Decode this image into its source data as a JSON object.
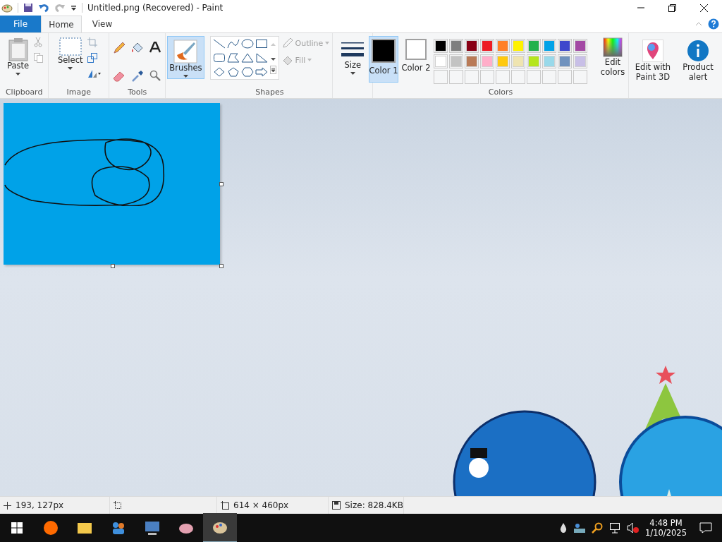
{
  "window": {
    "title": "Untitled.png (Recovered) - Paint"
  },
  "tabs": [
    {
      "label": "File",
      "kind": "file",
      "selected": false
    },
    {
      "label": "Home",
      "kind": "tab",
      "selected": true
    },
    {
      "label": "View",
      "kind": "tab",
      "selected": false
    }
  ],
  "ribbon": {
    "clipboard": {
      "label": "Clipboard",
      "paste": "Paste"
    },
    "image": {
      "label": "Image",
      "select": "Select"
    },
    "tools": {
      "label": "Tools"
    },
    "brushes": {
      "label": "Brushes",
      "selected": true
    },
    "shapes": {
      "label": "Shapes",
      "outline": "Outline",
      "fill": "Fill"
    },
    "size": {
      "label": "Size"
    },
    "colors": {
      "label": "Colors",
      "color1": {
        "label": "Color 1",
        "color": "#000000",
        "selected": true
      },
      "color2": {
        "label": "Color 2",
        "color": "#ffffff",
        "selected": false
      },
      "palette": [
        {
          "color": "#000000"
        },
        {
          "color": "#7f7f7f"
        },
        {
          "color": "#880015"
        },
        {
          "color": "#ed1c24"
        },
        {
          "color": "#ff7f27"
        },
        {
          "color": "#fff200"
        },
        {
          "color": "#22b14c"
        },
        {
          "color": "#00a2e8"
        },
        {
          "color": "#3f48cc"
        },
        {
          "color": "#a349a4"
        },
        {
          "color": "#ffffff"
        },
        {
          "color": "#c3c3c3"
        },
        {
          "color": "#b97a57"
        },
        {
          "color": "#ffaec9"
        },
        {
          "color": "#ffc90e"
        },
        {
          "color": "#efe4b0"
        },
        {
          "color": "#b5e61d"
        },
        {
          "color": "#99d9ea"
        },
        {
          "color": "#7092be"
        },
        {
          "color": "#c8bfe7"
        }
      ],
      "edit": "Edit colors"
    },
    "paint3d": "Edit with Paint 3D",
    "alert": "Product alert"
  },
  "status_bar": {
    "position": "193, 127px",
    "dimensions": "614 × 460px",
    "file_size": "Size: 828.4KB"
  },
  "taskbar": {
    "apps": [
      {
        "kind": "firefox",
        "selected": false
      },
      {
        "kind": "folder",
        "selected": false
      },
      {
        "kind": "people",
        "selected": false
      },
      {
        "kind": "computer",
        "selected": false
      },
      {
        "kind": "brush",
        "selected": false
      },
      {
        "kind": "palette",
        "selected": true
      }
    ],
    "time": "4:48 PM",
    "date": "1/10/2025"
  }
}
